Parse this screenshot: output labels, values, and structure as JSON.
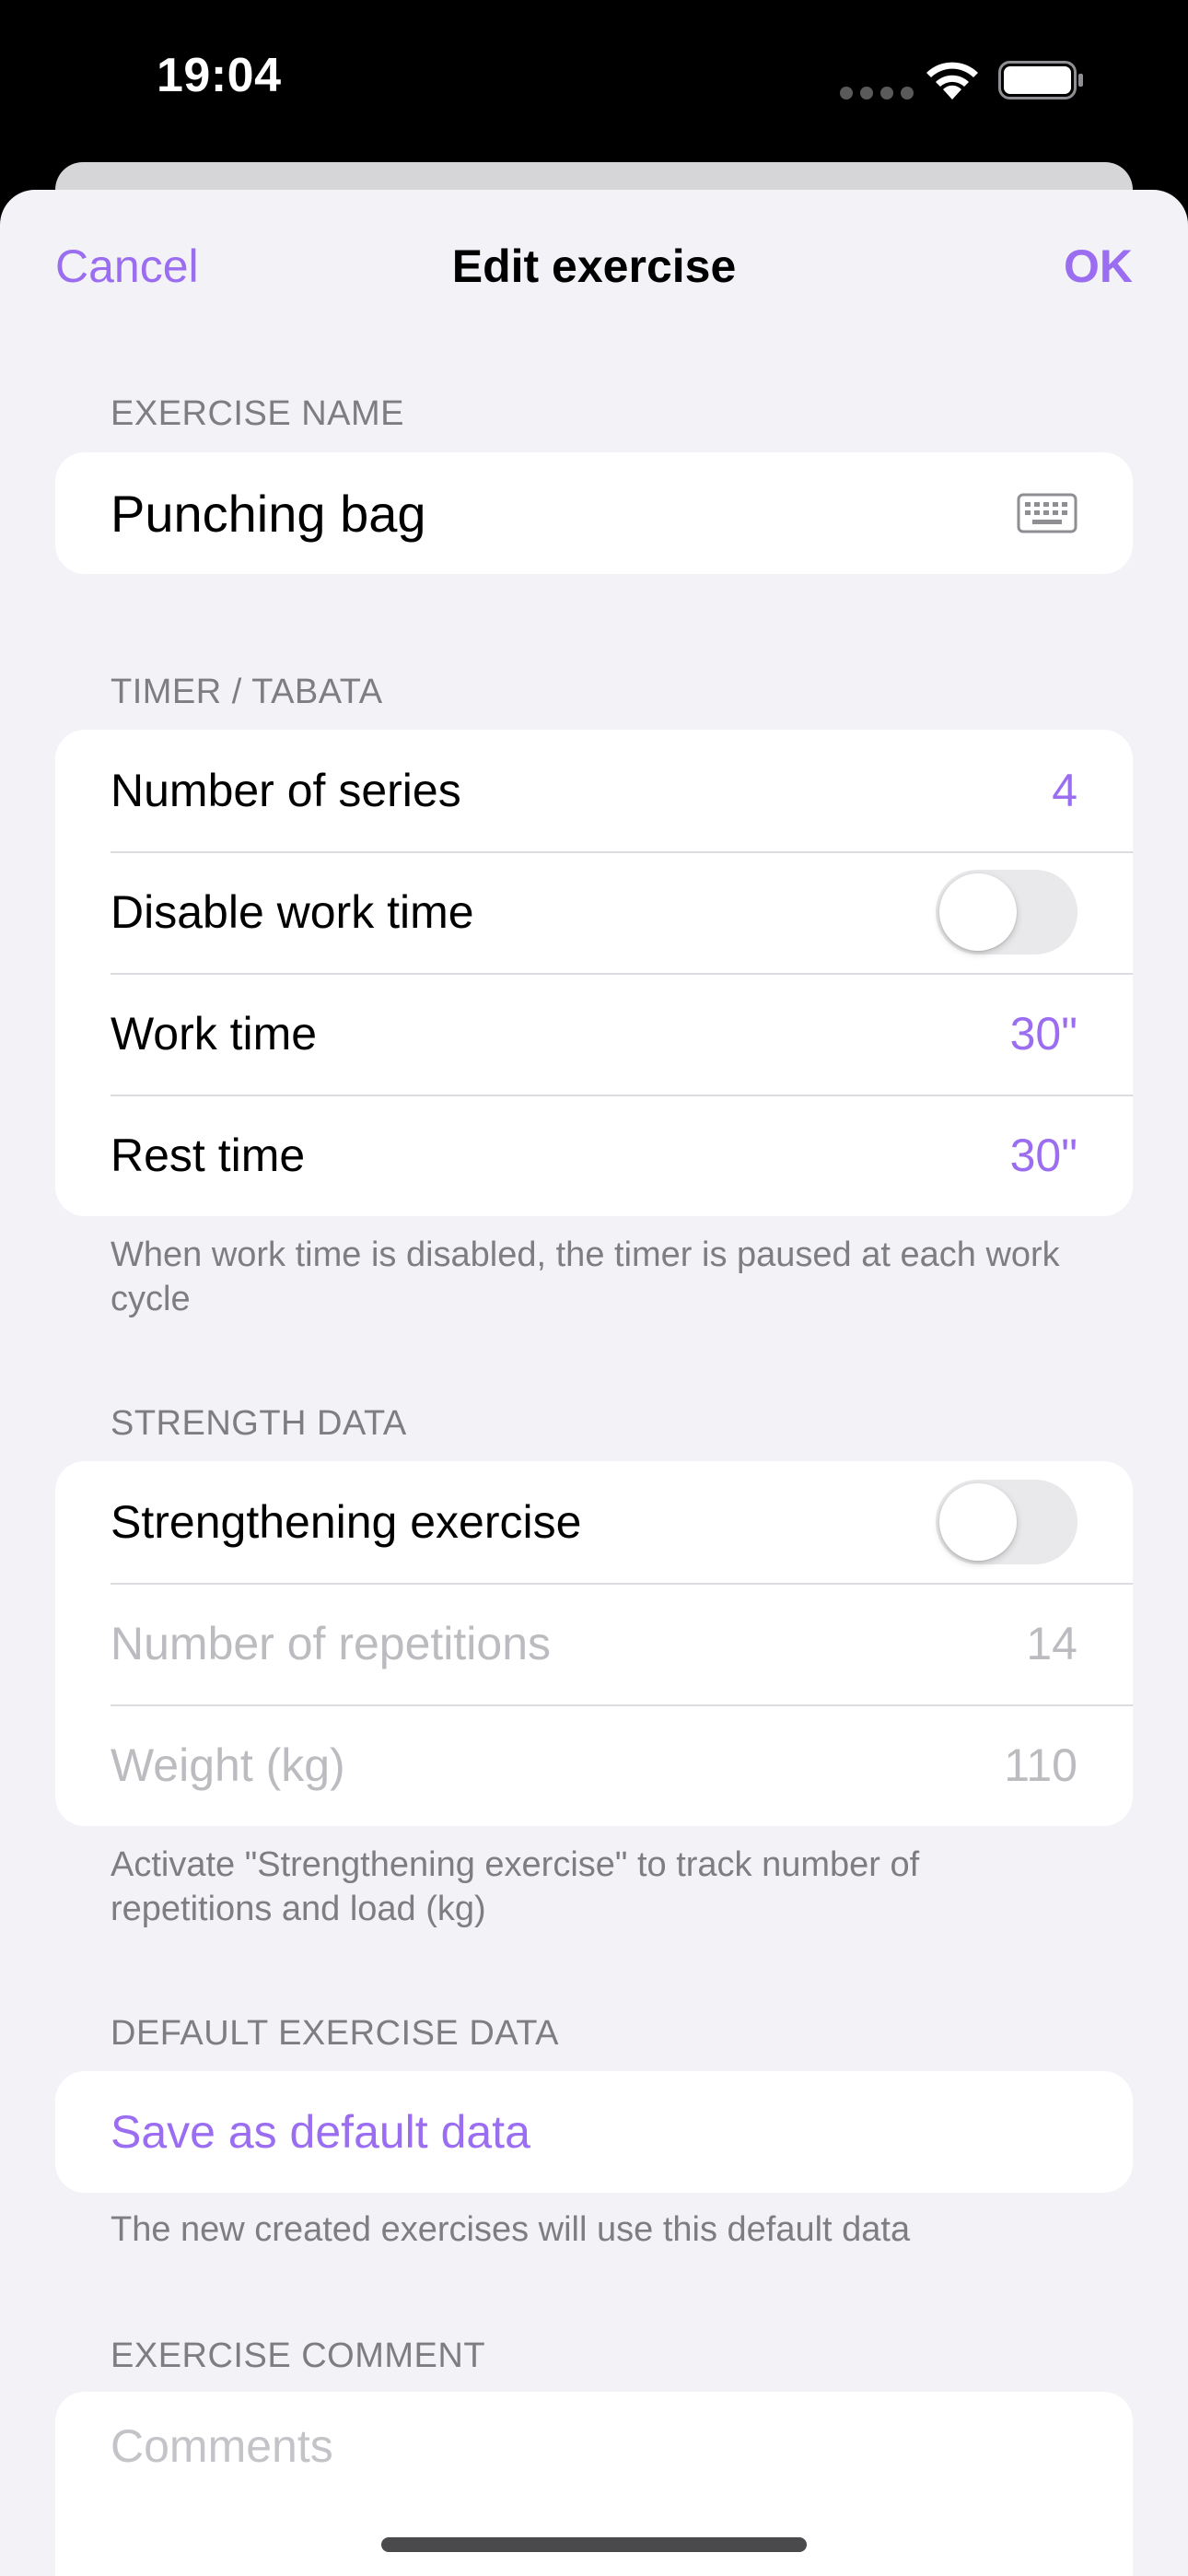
{
  "status_bar": {
    "time": "19:04",
    "icons": [
      "cellular-dots-icon",
      "wifi-icon",
      "battery-icon"
    ]
  },
  "nav": {
    "cancel_label": "Cancel",
    "title": "Edit exercise",
    "ok_label": "OK"
  },
  "exercise_name": {
    "header": "EXERCISE NAME",
    "value": "Punching bag",
    "icon": "keyboard-icon"
  },
  "timer": {
    "header": "TIMER / TABATA",
    "rows": {
      "series": {
        "label": "Number of series",
        "value": "4"
      },
      "disable_work": {
        "label": "Disable work time",
        "on": false
      },
      "work_time": {
        "label": "Work time",
        "value": "30\""
      },
      "rest_time": {
        "label": "Rest time",
        "value": "30\""
      }
    },
    "footer": "When work time is disabled, the timer is paused at each work cycle"
  },
  "strength": {
    "header": "STRENGTH DATA",
    "rows": {
      "strengthening": {
        "label": "Strengthening exercise",
        "on": false
      },
      "repetitions": {
        "label": "Number of repetitions",
        "value": "14"
      },
      "weight": {
        "label": "Weight (kg)",
        "value": "110"
      }
    },
    "footer": "Activate \"Strengthening exercise\" to track number of repetitions and load (kg)"
  },
  "default_data": {
    "header": "DEFAULT EXERCISE DATA",
    "action_label": "Save as default data",
    "footer": "The new created exercises will use this default data"
  },
  "comment": {
    "header": "EXERCISE COMMENT",
    "placeholder": "Comments",
    "value": ""
  },
  "colors": {
    "accent": "#9b6df0",
    "background": "#f2f2f7",
    "card": "#ffffff",
    "secondary_text": "#7d7d82",
    "disabled_text": "#bcbcc0"
  }
}
